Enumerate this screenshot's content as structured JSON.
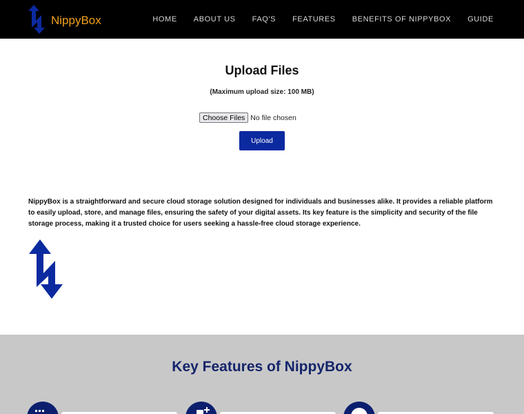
{
  "brand": {
    "name": "NippyBox",
    "text_color": "#f2a21b",
    "icon_color": "#0c2aa0"
  },
  "nav": {
    "items": [
      "HOME",
      "ABOUT US",
      "FAQ'S",
      "FEATURES",
      "BENEFITS OF NIPPYBOX",
      "GUIDE"
    ]
  },
  "upload": {
    "title": "Upload Files",
    "note": "(Maximum upload size: 100 MB)",
    "choose_label": "Choose Files",
    "no_file_text": "No file chosen",
    "upload_label": "Upload",
    "button_color": "#0c2aa0"
  },
  "about": {
    "description": "NippyBox is a straightforward and secure cloud storage solution designed for individuals and businesses alike. It provides a reliable platform to easily upload, store, and manage files, ensuring the safety of your digital assets. Its key feature is the simplicity and security of the file storage process, making it a trusted choice for users seeking a hassle-free cloud storage experience."
  },
  "features": {
    "title": "Key Features of NippyBox",
    "background": "#c8c8c8",
    "cards": [
      {
        "icon": "calendar-icon"
      },
      {
        "icon": "file-add-icon"
      },
      {
        "icon": "user-icon"
      }
    ]
  }
}
